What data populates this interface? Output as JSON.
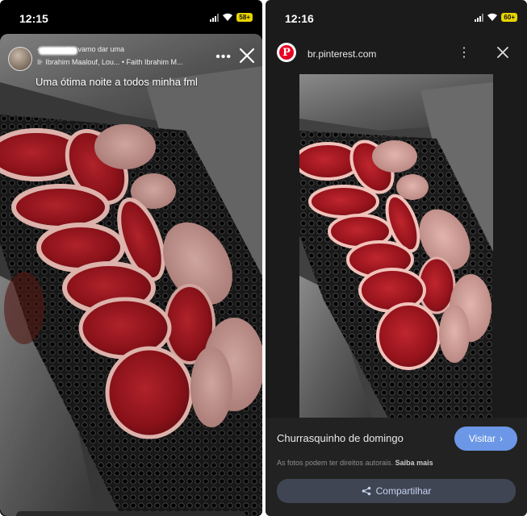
{
  "left_screen": {
    "status_time": "12:15",
    "battery": "58+",
    "story": {
      "meta_line1": "⟡ um gosto, vamo dar uma",
      "meta_line2": "⊪ Ibrahim Maalouf, Lou... • Faith Ibrahim M...",
      "caption": "Uma ótima noite a todos minha fml",
      "more_glyph": "•••"
    }
  },
  "right_screen": {
    "status_time": "12:16",
    "battery": "60+",
    "domain": "br.pinterest.com",
    "logo_glyph": "P",
    "kebab_glyph": "⋮",
    "pin_title": "Churrasquinho de domingo",
    "visit_label": "Visitar",
    "visit_chevron": "›",
    "rights_text": "As fotos podem ter direitos autorais.",
    "learn_more": "Saiba mais",
    "share_label": "Compartilhar"
  },
  "icons": {
    "wifi": "wifi-icon",
    "signal": "signal-icon",
    "close": "close-icon",
    "share": "share-icon",
    "pinterest": "pinterest-logo-icon"
  },
  "colors": {
    "pinterest_red": "#e60023",
    "visit_button": "#6b97e6",
    "share_button": "#3f4552",
    "battery": "#e8d400"
  }
}
